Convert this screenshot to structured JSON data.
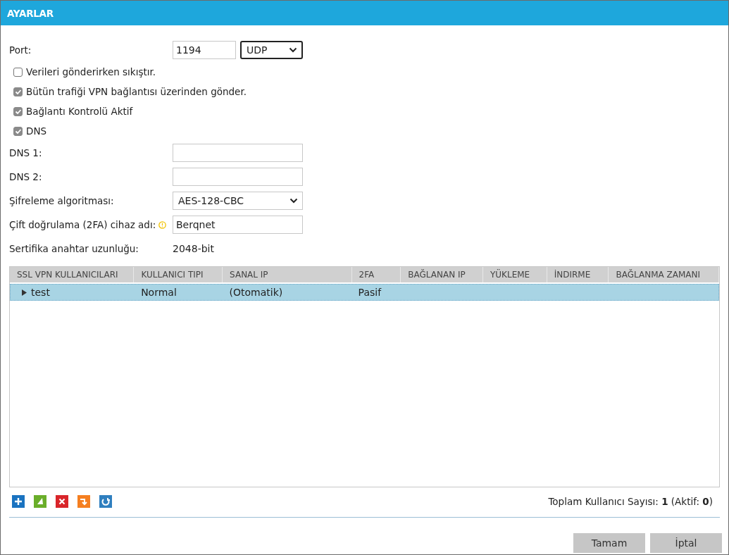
{
  "window": {
    "title": "AYARLAR"
  },
  "fields": [
    {
      "kind": "port",
      "label": "Port:",
      "value": "1194",
      "protocol": "UDP"
    },
    {
      "kind": "checkbox",
      "label": "Verileri gönderirken sıkıştır.",
      "checked": false
    },
    {
      "kind": "checkbox",
      "label": "Bütün trafiği VPN bağlantısı üzerinden gönder.",
      "checked": true
    },
    {
      "kind": "checkbox",
      "label": "Bağlantı Kontrolü Aktif",
      "checked": true
    },
    {
      "kind": "checkbox",
      "label": "DNS",
      "checked": true
    },
    {
      "kind": "input",
      "label": "DNS 1:"
    },
    {
      "kind": "input",
      "label": "DNS 2:"
    },
    {
      "kind": "select",
      "label": "Şifreleme algoritması:",
      "value": "AES-128-CBC"
    },
    {
      "kind": "input",
      "label": "Çift doğrulama (2FA) cihaz adı:",
      "value": "Berqnet",
      "info": true
    },
    {
      "kind": "static",
      "label": "Sertifika anahtar uzunluğu:",
      "value": "2048-bit"
    }
  ],
  "table": {
    "columns": [
      "SSL VPN KULLANICILARI",
      "KULLANICI TIPI",
      "SANAL IP",
      "2FA",
      "BAĞLANAN IP",
      "YÜKLEME",
      "İNDIRME",
      "BAĞLANMA ZAMANI"
    ],
    "rows": [
      {
        "expanded": false,
        "selected": true,
        "cells": [
          "test",
          "Normal",
          "(Otomatik)",
          "Pasif",
          "",
          "",
          "",
          ""
        ]
      }
    ]
  },
  "toolbar": [
    {
      "kind": "add"
    },
    {
      "kind": "edit"
    },
    {
      "kind": "delete"
    },
    {
      "kind": "import"
    },
    {
      "kind": "refresh"
    }
  ],
  "summary": "Toplam Kullanıcı Sayısı: **1** (Aktif: **0**)",
  "buttons": [
    "Tamam",
    "İptal"
  ]
}
